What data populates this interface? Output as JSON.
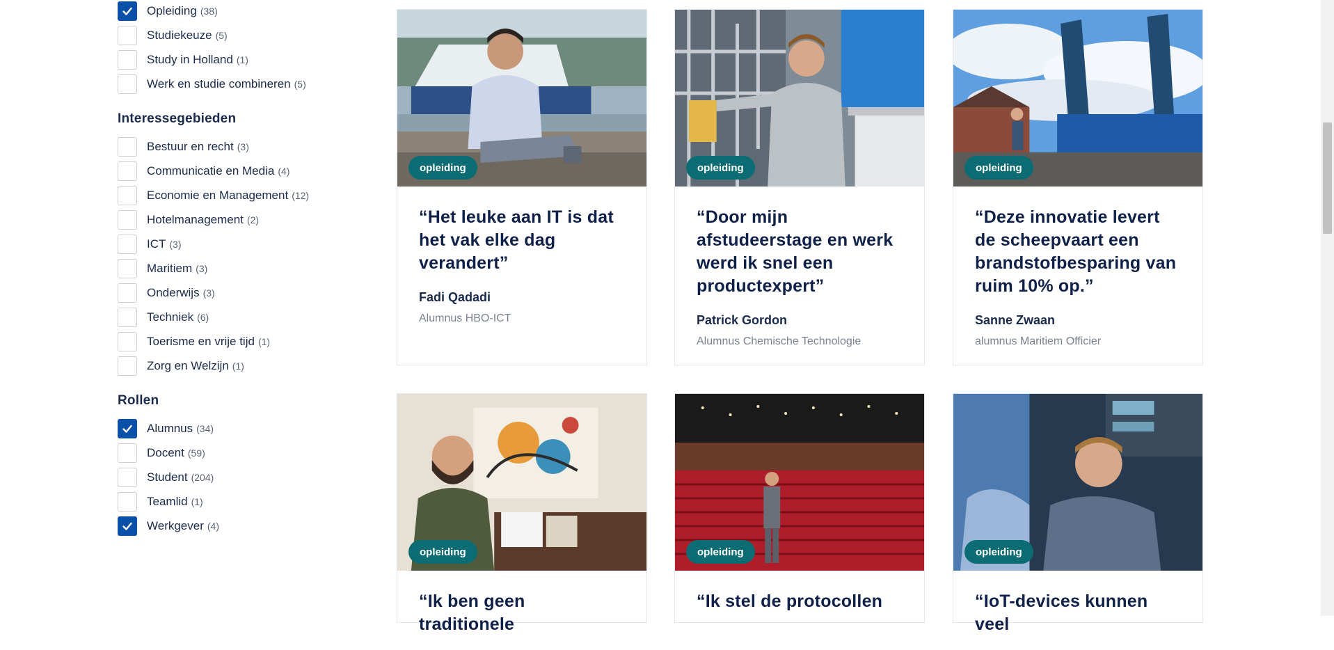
{
  "filters": {
    "top_items": [
      {
        "label": "Opleiding",
        "count": "(38)",
        "checked": true
      },
      {
        "label": "Studiekeuze",
        "count": "(5)",
        "checked": false
      },
      {
        "label": "Study in Holland",
        "count": "(1)",
        "checked": false
      },
      {
        "label": "Werk en studie combineren",
        "count": "(5)",
        "checked": false
      }
    ],
    "interest": {
      "title": "Interessegebieden",
      "items": [
        {
          "label": "Bestuur en recht",
          "count": "(3)",
          "checked": false
        },
        {
          "label": "Communicatie en Media",
          "count": "(4)",
          "checked": false
        },
        {
          "label": "Economie en Management",
          "count": "(12)",
          "checked": false
        },
        {
          "label": "Hotelmanagement",
          "count": "(2)",
          "checked": false
        },
        {
          "label": "ICT",
          "count": "(3)",
          "checked": false
        },
        {
          "label": "Maritiem",
          "count": "(3)",
          "checked": false
        },
        {
          "label": "Onderwijs",
          "count": "(3)",
          "checked": false
        },
        {
          "label": "Techniek",
          "count": "(6)",
          "checked": false
        },
        {
          "label": "Toerisme en vrije tijd",
          "count": "(1)",
          "checked": false
        },
        {
          "label": "Zorg en Welzijn",
          "count": "(1)",
          "checked": false
        }
      ]
    },
    "roles": {
      "title": "Rollen",
      "items": [
        {
          "label": "Alumnus",
          "count": "(34)",
          "checked": true
        },
        {
          "label": "Docent",
          "count": "(59)",
          "checked": false
        },
        {
          "label": "Student",
          "count": "(204)",
          "checked": false
        },
        {
          "label": "Teamlid",
          "count": "(1)",
          "checked": false
        },
        {
          "label": "Werkgever",
          "count": "(4)",
          "checked": true
        }
      ]
    }
  },
  "cards": [
    {
      "badge": "opleiding",
      "quote": "“Het leuke aan IT is dat het vak elke dag verandert”",
      "name": "Fadi Qadadi",
      "role": "Alumnus HBO-ICT",
      "photo": "man-on-dock-photo"
    },
    {
      "badge": "opleiding",
      "quote": "“Door mijn afstudeerstage en werk werd ik snel een productexpert”",
      "name": "Patrick Gordon",
      "role": "Alumnus Chemische Technologie",
      "photo": "man-in-lab-photo"
    },
    {
      "badge": "opleiding",
      "quote": "“Deze innovatie levert de scheepvaart een brandstofbesparing van ruim 10% op.”",
      "name": "Sanne Zwaan",
      "role": "alumnus Maritiem Officier",
      "photo": "econowind-container-photo"
    },
    {
      "badge": "opleiding",
      "quote": "“Ik ben geen traditionele",
      "name": "",
      "role": "",
      "photo": "man-with-painting-photo"
    },
    {
      "badge": "opleiding",
      "quote": "“Ik stel de protocollen",
      "name": "",
      "role": "",
      "photo": "man-in-theater-photo"
    },
    {
      "badge": "opleiding",
      "quote": "“IoT-devices kunnen veel",
      "name": "",
      "role": "",
      "photo": "man-at-computer-photo"
    }
  ],
  "colors": {
    "checkbox_checked": "#0a4fa8",
    "badge": "#0b6d73",
    "heading": "#0f2148"
  }
}
